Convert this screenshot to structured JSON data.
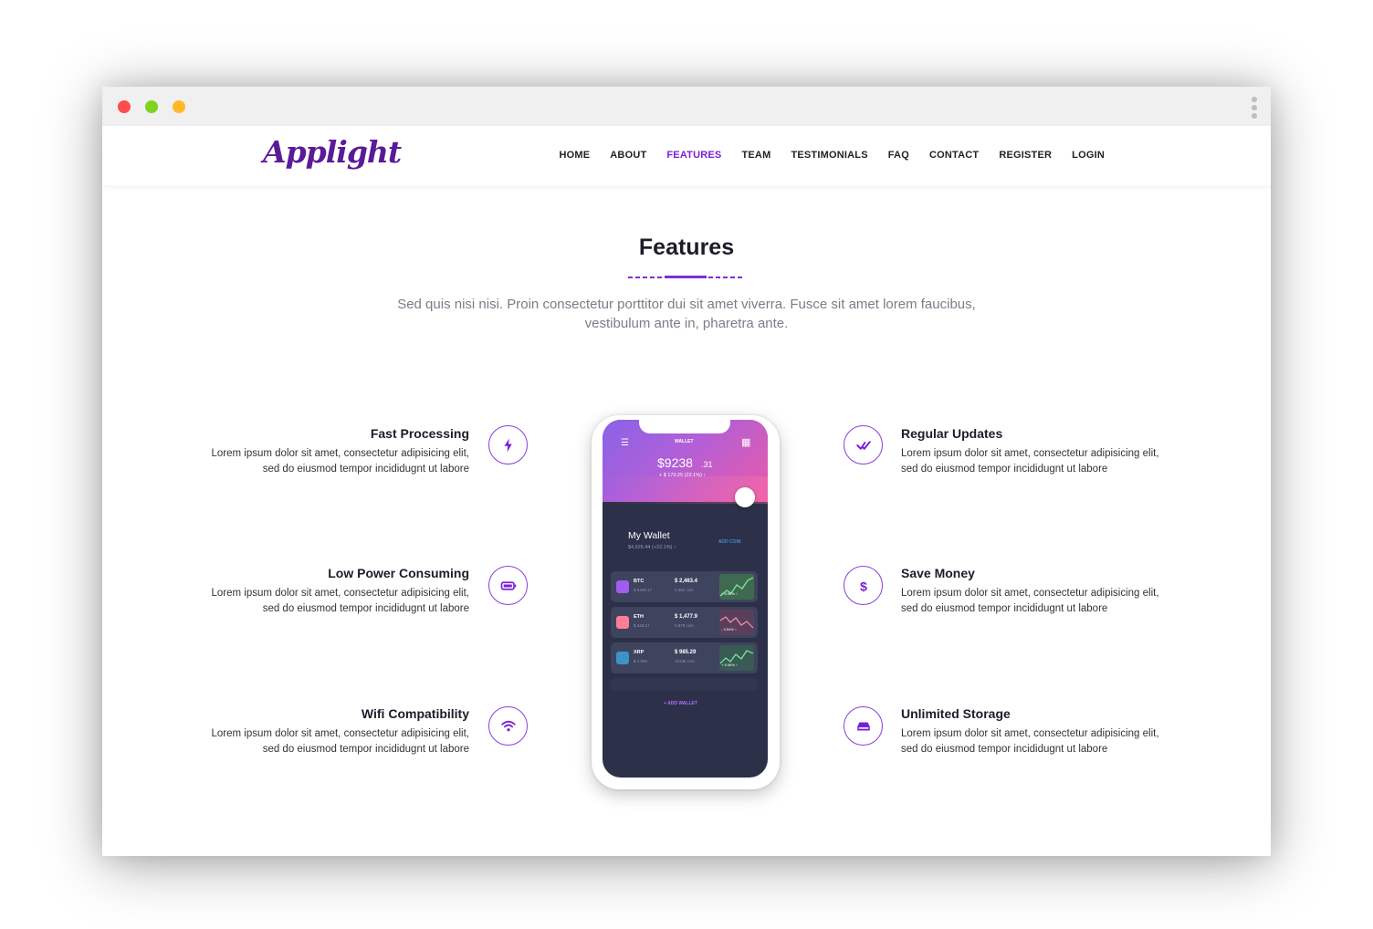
{
  "window": {
    "controls": [
      "close",
      "minimize",
      "maximize"
    ]
  },
  "nav": {
    "logo": "Applight",
    "items": [
      {
        "label": "HOME",
        "active": false
      },
      {
        "label": "ABOUT",
        "active": false
      },
      {
        "label": "FEATURES",
        "active": true
      },
      {
        "label": "TEAM",
        "active": false
      },
      {
        "label": "TESTIMONIALS",
        "active": false
      },
      {
        "label": "FAQ",
        "active": false
      },
      {
        "label": "CONTACT",
        "active": false
      },
      {
        "label": "REGISTER",
        "active": false
      },
      {
        "label": "LOGIN",
        "active": false
      }
    ]
  },
  "section": {
    "title": "Features",
    "subtitle": "Sed quis nisi nisi. Proin consectetur porttitor dui sit amet viverra. Fusce sit amet lorem faucibus, vestibulum ante in, pharetra ante."
  },
  "features_left": [
    {
      "title": "Fast Processing",
      "text": "Lorem ipsum dolor sit amet, consectetur adipisicing elit, sed do eiusmod tempor incididugnt ut labore",
      "icon": "bolt-icon"
    },
    {
      "title": "Low Power Consuming",
      "text": "Lorem ipsum dolor sit amet, consectetur adipisicing elit, sed do eiusmod tempor incididugnt ut labore",
      "icon": "battery-icon"
    },
    {
      "title": "Wifi Compatibility",
      "text": "Lorem ipsum dolor sit amet, consectetur adipisicing elit, sed do eiusmod tempor incididugnt ut labore",
      "icon": "wifi-icon"
    }
  ],
  "features_right": [
    {
      "title": "Regular Updates",
      "text": "Lorem ipsum dolor sit amet, consectetur adipisicing elit, sed do eiusmod tempor incididugnt ut labore",
      "icon": "double-check-icon"
    },
    {
      "title": "Save Money",
      "text": "Lorem ipsum dolor sit amet, consectetur adipisicing elit, sed do eiusmod tempor incididugnt ut labore",
      "icon": "dollar-icon"
    },
    {
      "title": "Unlimited Storage",
      "text": "Lorem ipsum dolor sit amet, consectetur adipisicing elit, sed do eiusmod tempor incididugnt ut labore",
      "icon": "storage-icon"
    }
  ],
  "phone": {
    "header": "WALLET",
    "balance_main": "$9238",
    "balance_cents": ".31",
    "balance_change": "+ $ 170.25 (22.1%) ↑",
    "wallet_title": "My Wallet",
    "wallet_sub": "$4,926.44 (+22.1%) ↑",
    "add_coin": "ADD COIN",
    "add_wallet": "+ ADD WALLET",
    "coins": [
      {
        "symbol": "BTC",
        "sub": "$ 6448.17",
        "value": "$ 2,463.4",
        "amount": "0.382 coin",
        "change": "+ 8.56% ↑",
        "color": "#a35cf0",
        "trend": "up"
      },
      {
        "symbol": "ETH",
        "sub": "$ 348.17",
        "value": "$ 1,477.9",
        "amount": "4.879 coin",
        "change": "- 3.54% ↓",
        "color": "#ff7e94",
        "trend": "down"
      },
      {
        "symbol": "XRP",
        "sub": "$ 1.053",
        "value": "$ 985.29",
        "amount": "10135 coin",
        "change": "+ 8.56% ↑",
        "color": "#3d93c9",
        "trend": "up"
      }
    ]
  },
  "colors": {
    "accent": "#7a1fd6",
    "logo": "#5b1a98",
    "screen_bg": "#2c3048"
  }
}
